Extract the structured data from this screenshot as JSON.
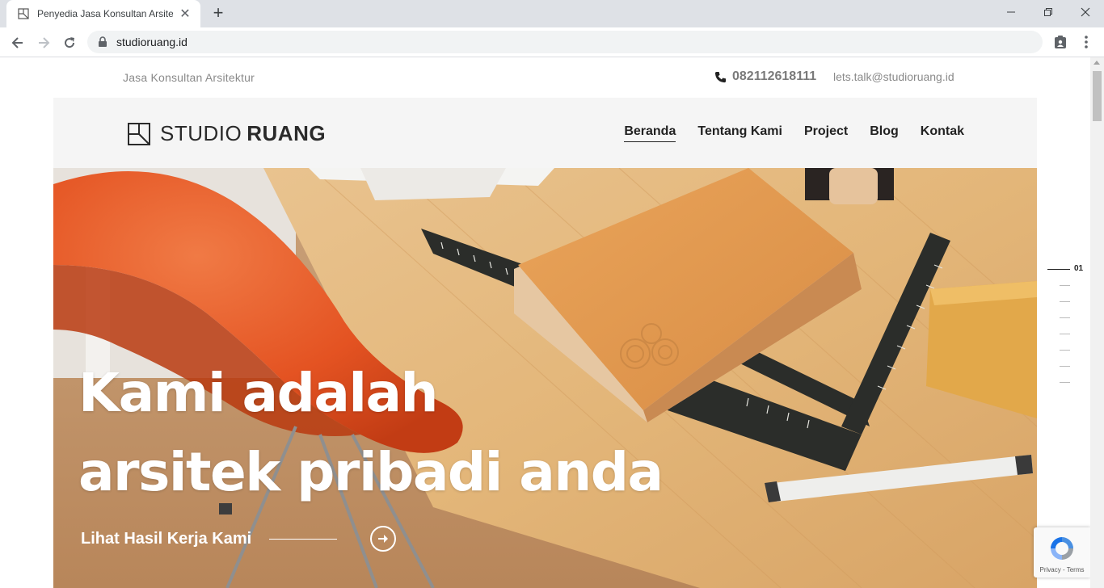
{
  "browser": {
    "tab_title": "Penyedia Jasa Konsultan Arsitektur",
    "new_tab_label": "+",
    "close_tab_label": "✕",
    "url": "studioruang.id"
  },
  "topbar": {
    "tagline": "Jasa Konsultan Arsitektur",
    "phone": "082112618111",
    "email": "lets.talk@studioruang.id"
  },
  "brand": {
    "name_light": "STUDIO",
    "name_bold": "RUANG"
  },
  "nav": {
    "items": [
      {
        "label": "Beranda",
        "active": true
      },
      {
        "label": "Tentang Kami",
        "active": false
      },
      {
        "label": "Project",
        "active": false
      },
      {
        "label": "Blog",
        "active": false
      },
      {
        "label": "Kontak",
        "active": false
      }
    ]
  },
  "hero": {
    "title_line1": "Kami adalah",
    "title_line2": "arsitek pribadi anda",
    "cta_label": "Lihat Hasil Kerja Kami"
  },
  "slider": {
    "current": "01",
    "total_slides": 8
  },
  "recaptcha": {
    "links": "Privacy - Terms"
  },
  "colors": {
    "header_bg": "#f5f5f5",
    "text_dark": "#222222",
    "text_muted": "#8a8a8a",
    "chair_orange": "#e8592a",
    "wood": "#d9a86a"
  }
}
